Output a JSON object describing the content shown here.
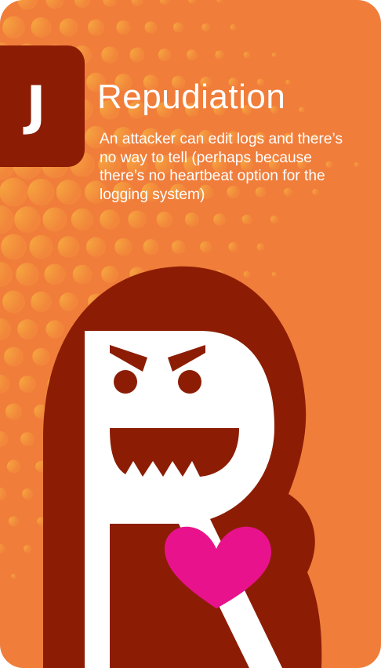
{
  "card": {
    "rank": "J",
    "title": "Repudiation",
    "description": "An attacker can edit logs and there’s no way to tell (perhaps because there’s no heartbeat option for the logging system)"
  },
  "colors": {
    "background": "#f07d3a",
    "dots": "#f6a540",
    "badge": "#8c1d04",
    "hood": "#8c1d04",
    "letter": "#ffffff",
    "heart": "#e8128c"
  },
  "icons": {
    "character": "hooded-letter-r-monster-icon",
    "heart": "heart-icon"
  }
}
